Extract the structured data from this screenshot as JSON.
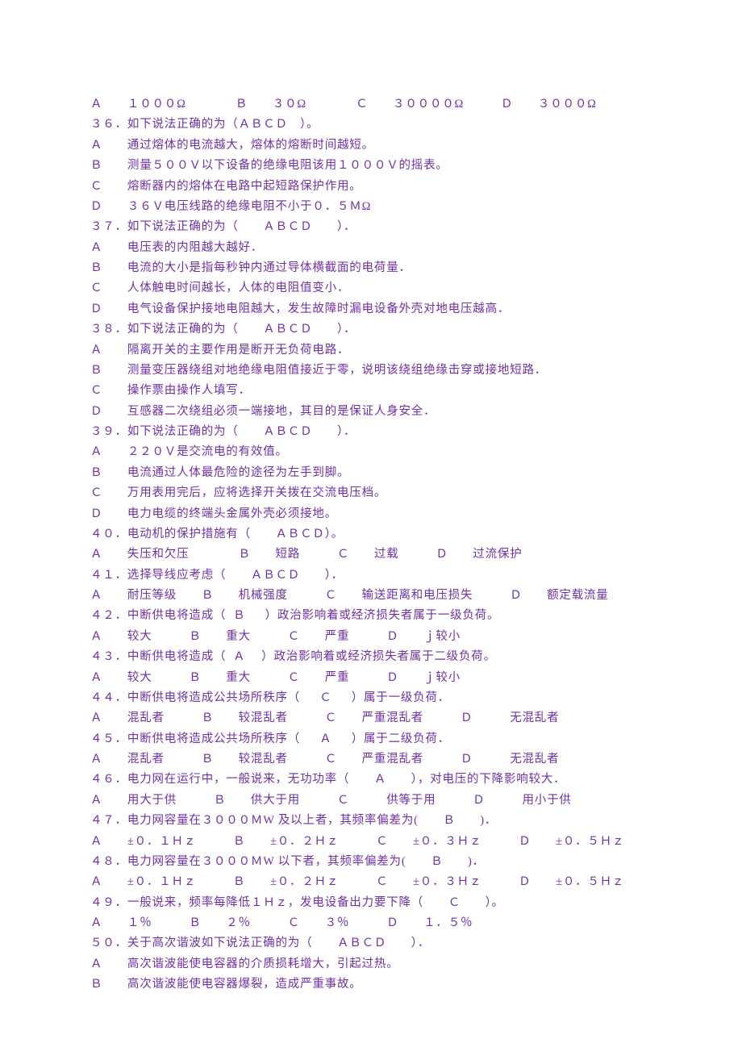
{
  "lines": [
    "Ａ　　１０００Ω　　　　Ｂ　　３０Ω　　　　Ｃ　　３００００Ω　　　Ｄ　　３０００Ω",
    "３６．如下说法正确的为（ＡＢＣＤ　）。",
    "Ａ　　通过熔体的电流越大，熔体的熔断时间越短。",
    "Ｂ　　测量５００Ｖ以下设备的绝缘电阻该用１０００Ｖ的摇表。",
    "Ｃ　　熔断器内的熔体在电路中起短路保护作用。",
    "Ｄ　　３６Ｖ电压线路的绝缘电阻不小于０．５ＭΩ",
    "３７．如下说法正确的为（　　ＡＢＣＤ　　）．",
    "Ａ　　电压表的内阻越大越好．",
    "Ｂ　　电流的大小是指每秒钟内通过导体横截面的电荷量．",
    "Ｃ　　人体触电时间越长，人体的电阻值变小．",
    "Ｄ　　电气设备保护接地电阻越大，发生故障时漏电设备外壳对地电压越高．",
    "３８．如下说法正确的为（　　ＡＢＣＤ　　）．",
    "Ａ　　隔离开关的主要作用是断开无负荷电路．",
    "Ｂ　　测量变压器绕组对地绝缘电阻值接近于零，说明该绕组绝缘击穿或接地短路．",
    "Ｃ　　操作票由操作人填写．",
    "Ｄ　　互感器二次绕组必须一端接地，其目的是保证人身安全．",
    "３９．如下说法正确的为（　　ＡＢＣＤ　　）．",
    "Ａ　　２２０Ｖ是交流电的有效值。",
    "Ｂ　　电流通过人体最危险的途径为左手到脚。",
    "Ｃ　　万用表用完后，应将选择开关拨在交流电压档。",
    "Ｄ　　电力电缆的终端头金属外壳必须接地。",
    "４０．电动机的保护措施有（　　ＡＢＣＤ）。",
    "Ａ　　失压和欠压　　　　Ｂ　　短路　　　Ｃ　　过载　　　Ｄ　　过流保护",
    "４１．选择导线应考虑（　　ＡＢＣＤ　　）．",
    "Ａ　　耐压等级　　Ｂ　　机械强度　　　Ｃ　　输送距离和电压损失　　　Ｄ　　额定载流量",
    "４２．中断供电将造成（  Ｂ　  ）政治影响着或经济损失者属于一级负荷。",
    "Ａ　　较大　　　Ｂ　　重大　　　Ｃ　　严重　　　Ｄ　　ｊ较小",
    "４３．中断供电将造成（  Ａ　 ）政治影响着或经济损失者属于二级负荷。",
    "Ａ　　较大　　　Ｂ　　重大　　　Ｃ　　严重　　　Ｄ　　ｊ较小",
    "４４．中断供电将造成公共场所秩序（ 　 Ｃ　  ）属于一级负荷．",
    "Ａ　　混乱者　　　Ｂ　　较混乱者　　　Ｃ　　严重混乱者　　　Ｄ　　　无混乱者",
    "４５．中断供电将造成公共场所秩序（ 　 Ａ　  ）属于二级负荷．",
    "Ａ　　混乱者　　　Ｂ　　较混乱者　　　Ｃ　　严重混乱者　　　Ｄ　　　无混乱者",
    "４６．电力网在运行中，一般说来，无功功率（　　Ａ　　），对电压的下降影响较大．",
    "Ａ　　用大于供　　　Ｂ　　供大于用　　　Ｃ　　　供等于用　　　Ｄ　　　用小于供",
    "４７．电力网容量在３０００ＭW 及以上者，其频率偏差为(　　Ｂ　　)．",
    "Ａ　　±０．１Ｈｚ　　　Ｂ　　±０．２Ｈｚ　　　Ｃ　　±０．３Ｈｚ　　　Ｄ　　±０．５Ｈｚ",
    "４８．电力网容量在３０００ＭW 以下者，其频率偏差为(　　Ｂ　　)．",
    "Ａ　　±０．１Ｈｚ　　　Ｂ　　±０．２Ｈｚ　　　Ｃ　　±０．３Ｈｚ　　　Ｄ　　±０．５Ｈｚ",
    "４９．一般说来，频率每降低１Ｈｚ，发电设备出力要下降（　　Ｃ　　）。",
    "Ａ　　１％　　　Ｂ　　２％　　　Ｃ　　３％　　　Ｄ　　１．５％",
    "５０．关于高次谐波如下说法正确的为（　　ＡＢＣＤ　　）．",
    "Ａ　　高次谐波能使电容器的介质损耗增大，引起过热。",
    "Ｂ　　高次谐波能使电容器爆裂，造成严重事故。"
  ]
}
